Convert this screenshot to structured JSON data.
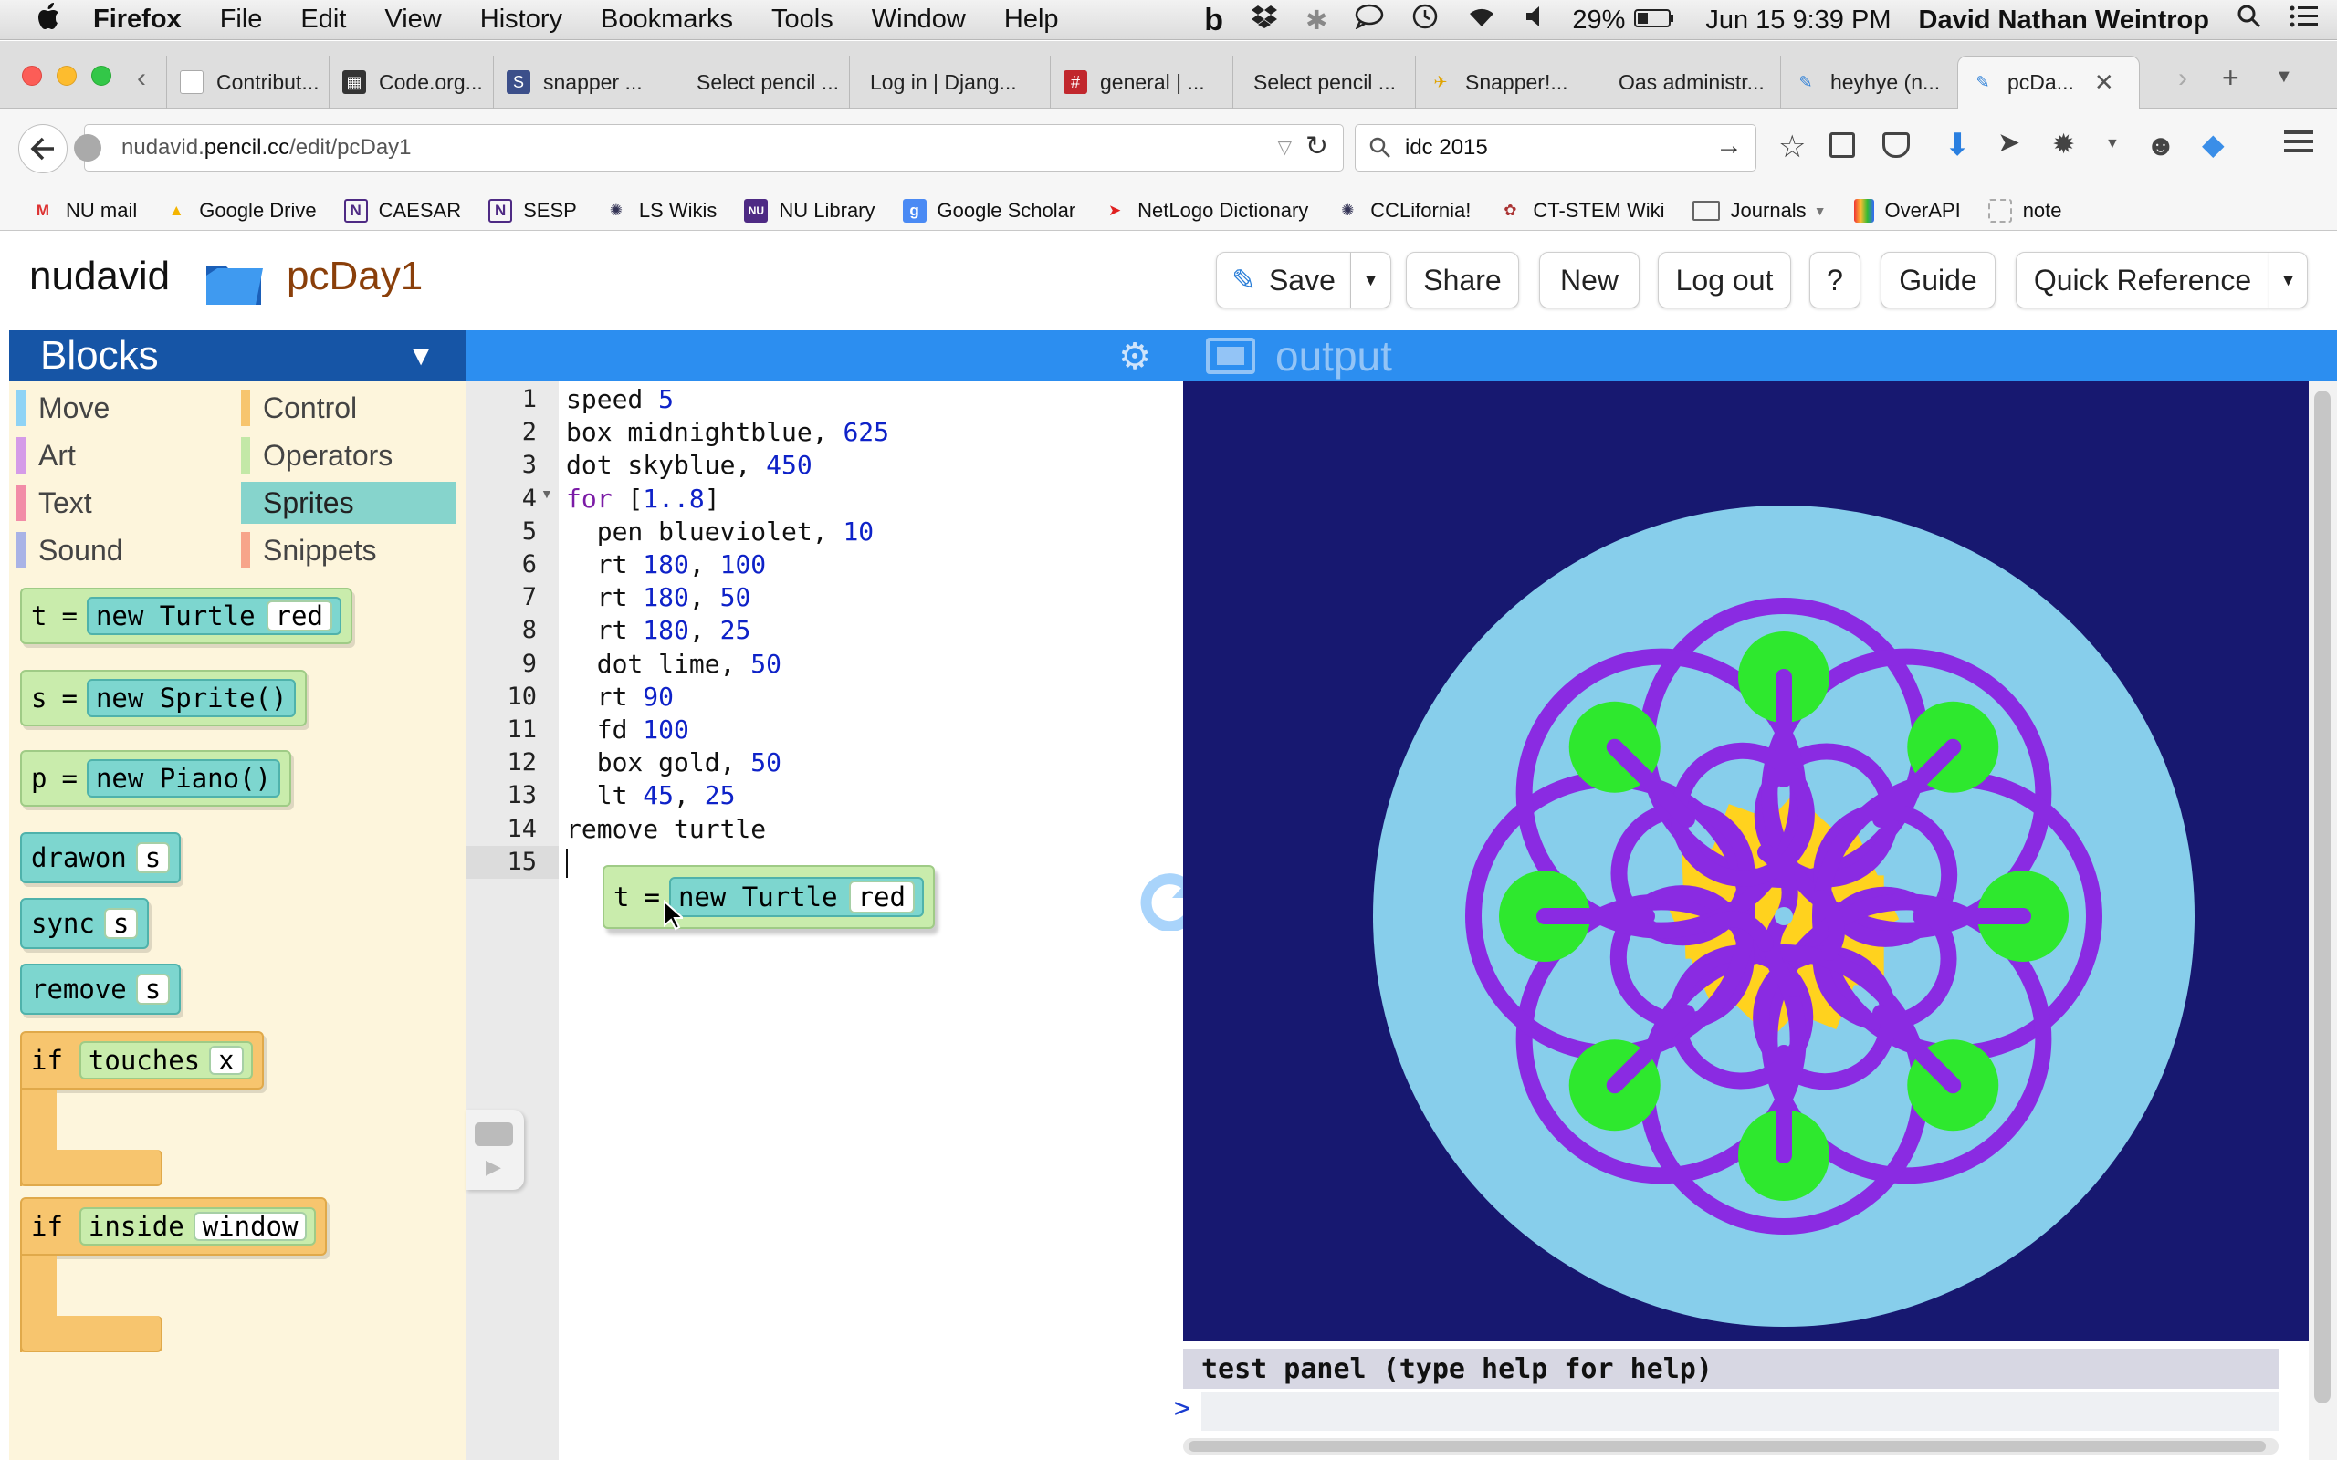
{
  "menubar": {
    "app": "Firefox",
    "items": [
      "File",
      "Edit",
      "View",
      "History",
      "Bookmarks",
      "Tools",
      "Window",
      "Help"
    ],
    "battery": "29%",
    "datetime": "Jun 15  9:39 PM",
    "user": "David Nathan Weintrop"
  },
  "tabs": [
    {
      "label": "Contribut...",
      "active": false
    },
    {
      "label": "Code.org...",
      "active": false
    },
    {
      "label": "snapper ...",
      "active": false
    },
    {
      "label": "Select pencil ...",
      "active": false
    },
    {
      "label": "Log in | Djang...",
      "active": false
    },
    {
      "label": "general | ...",
      "active": false
    },
    {
      "label": "Select pencil ...",
      "active": false
    },
    {
      "label": "Snapper!...",
      "active": false
    },
    {
      "label": "Oas administr...",
      "active": false
    },
    {
      "label": "heyhye (n...",
      "active": false
    },
    {
      "label": "pcDa...",
      "active": true
    }
  ],
  "navbar": {
    "url_prefix": "nudavid.",
    "url_domain": "pencil.cc",
    "url_path": "/edit/pcDay1",
    "search": "idc 2015"
  },
  "bookmarks": [
    {
      "label": "NU mail",
      "icon": "gmail-icon"
    },
    {
      "label": "Google Drive",
      "icon": "drive-icon"
    },
    {
      "label": "CAESAR",
      "icon": "n-icon"
    },
    {
      "label": "SESP",
      "icon": "n-icon"
    },
    {
      "label": "LS Wikis",
      "icon": "wiki-icon"
    },
    {
      "label": "NU Library",
      "icon": "library-icon"
    },
    {
      "label": "Google Scholar",
      "icon": "scholar-icon"
    },
    {
      "label": "NetLogo Dictionary",
      "icon": "netlogo-icon"
    },
    {
      "label": "CCLifornia!",
      "icon": "ccl-icon"
    },
    {
      "label": "CT-STEM Wiki",
      "icon": "ctstem-icon"
    },
    {
      "label": "Journals",
      "icon": "folder-icon"
    },
    {
      "label": "OverAPI",
      "icon": "overapi-icon"
    },
    {
      "label": "note",
      "icon": "note-icon"
    }
  ],
  "app": {
    "user": "nudavid",
    "project": "pcDay1",
    "buttons": {
      "save": "Save",
      "share": "Share",
      "new": "New",
      "logout": "Log out",
      "help": "?",
      "guide": "Guide",
      "quickref": "Quick Reference"
    }
  },
  "blocks": {
    "title": "Blocks",
    "categories": [
      {
        "label": "Move",
        "color": "#8fd3f5"
      },
      {
        "label": "Control",
        "color": "#f7c56e"
      },
      {
        "label": "Art",
        "color": "#d59be8"
      },
      {
        "label": "Operators",
        "color": "#c3e8a7"
      },
      {
        "label": "Text",
        "color": "#f28ca7"
      },
      {
        "label": "Sprites",
        "color": "#86d4cc"
      },
      {
        "label": "Sound",
        "color": "#a9b3e6"
      },
      {
        "label": "Snippets",
        "color": "#f7a58a"
      }
    ],
    "palette": {
      "turtle_var": "t",
      "turtle_eq": "=",
      "turtle_new": "new Turtle",
      "turtle_color": "red",
      "sprite_var": "s",
      "sprite_eq": "=",
      "sprite_new": "new Sprite()",
      "piano_var": "p",
      "piano_eq": "=",
      "piano_new": "new Piano()",
      "drawon": "drawon",
      "drawon_arg": "s",
      "sync": "sync",
      "sync_arg": "s",
      "remove": "remove",
      "remove_arg": "s",
      "if1": "if",
      "touches": "touches",
      "touches_arg": "x",
      "if2": "if",
      "inside": "inside",
      "inside_arg": "window"
    }
  },
  "editor": {
    "lines": [
      [
        {
          "t": "speed "
        },
        {
          "t": "5",
          "c": "num"
        }
      ],
      [
        {
          "t": "box midnightblue, "
        },
        {
          "t": "625",
          "c": "num"
        }
      ],
      [
        {
          "t": "dot skyblue, "
        },
        {
          "t": "450",
          "c": "num"
        }
      ],
      [
        {
          "t": "for ",
          "c": "kw"
        },
        {
          "t": "[",
          "c": ""
        },
        {
          "t": "1..8",
          "c": "num"
        },
        {
          "t": "]"
        }
      ],
      [
        {
          "t": "  pen blueviolet, "
        },
        {
          "t": "10",
          "c": "num"
        }
      ],
      [
        {
          "t": "  rt "
        },
        {
          "t": "180",
          "c": "num"
        },
        {
          "t": ", "
        },
        {
          "t": "100",
          "c": "num"
        }
      ],
      [
        {
          "t": "  rt "
        },
        {
          "t": "180",
          "c": "num"
        },
        {
          "t": ", "
        },
        {
          "t": "50",
          "c": "num"
        }
      ],
      [
        {
          "t": "  rt "
        },
        {
          "t": "180",
          "c": "num"
        },
        {
          "t": ", "
        },
        {
          "t": "25",
          "c": "num"
        }
      ],
      [
        {
          "t": "  dot lime, "
        },
        {
          "t": "50",
          "c": "num"
        }
      ],
      [
        {
          "t": "  rt "
        },
        {
          "t": "90",
          "c": "num"
        }
      ],
      [
        {
          "t": "  fd "
        },
        {
          "t": "100",
          "c": "num"
        }
      ],
      [
        {
          "t": "  box gold, "
        },
        {
          "t": "50",
          "c": "num"
        }
      ],
      [
        {
          "t": "  lt "
        },
        {
          "t": "45",
          "c": "num"
        },
        {
          "t": ", "
        },
        {
          "t": "25",
          "c": "num"
        }
      ],
      [
        {
          "t": "remove turtle"
        }
      ],
      []
    ],
    "dragged": {
      "var": "t",
      "eq": "=",
      "new": "new Turtle",
      "color": "red"
    }
  },
  "output": {
    "title": "output"
  },
  "test_panel": {
    "title": "test panel (type help for help)",
    "prompt": ">"
  }
}
